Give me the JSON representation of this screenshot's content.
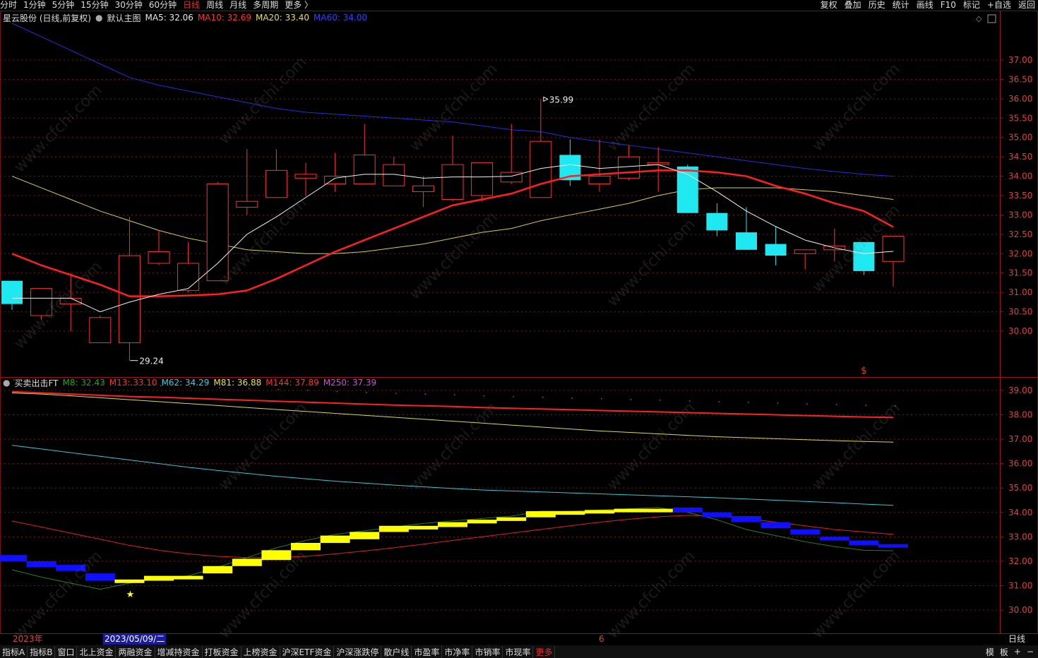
{
  "topbar": {
    "periods": [
      "分时",
      "1分钟",
      "5分钟",
      "15分钟",
      "30分钟",
      "60分钟",
      "日线",
      "周线",
      "月线",
      "多周期",
      "更多 〉"
    ],
    "active_period": "日线",
    "right_buttons": [
      "复权",
      "叠加",
      "历史",
      "统计",
      "画线",
      "F10",
      "标记",
      "+自选",
      "返回"
    ]
  },
  "main_chart": {
    "stock_label": "星云股份 (日线,前复权)",
    "template_label": "默认主图",
    "ma": [
      {
        "name": "MA5",
        "value": "32.06",
        "color": "#e8e8e8"
      },
      {
        "name": "MA10",
        "value": "32.69",
        "color": "#ff3030"
      },
      {
        "name": "MA20",
        "value": "33.40",
        "color": "#e8e040"
      },
      {
        "name": "MA60",
        "value": "34.00",
        "color": "#3040ff"
      }
    ],
    "high_label": "35.99",
    "low_label": "29.24",
    "signal_marker": "$",
    "y_ticks": [
      "37.00",
      "36.50",
      "36.00",
      "35.50",
      "35.00",
      "34.50",
      "34.00",
      "33.50",
      "33.00",
      "32.50",
      "32.00",
      "31.50",
      "31.00",
      "30.50",
      "30.00"
    ]
  },
  "sub_chart": {
    "indicator": "买卖出击FT",
    "lines": [
      {
        "name": "M8",
        "value": "32.43",
        "color": "#20a020"
      },
      {
        "name": "M13",
        "value": "33.10",
        "color": "#ff3030"
      },
      {
        "name": "M62",
        "value": "34.29",
        "color": "#30d0e0"
      },
      {
        "name": "M81",
        "value": "36.88",
        "color": "#e8e040"
      },
      {
        "name": "M144",
        "value": "37.89",
        "color": "#ff3030"
      },
      {
        "name": "M250",
        "value": "37.39",
        "color": "#e040e0"
      }
    ],
    "y_ticks": [
      "39.00",
      "38.00",
      "37.00",
      "36.00",
      "35.00",
      "34.00",
      "33.00",
      "32.00",
      "31.00",
      "30.00"
    ],
    "star_marker": "★"
  },
  "chart_data": {
    "type": "candlestick",
    "candles": [
      {
        "o": 31.3,
        "c": 30.7,
        "h": 31.3,
        "l": 30.55
      },
      {
        "o": 30.4,
        "c": 31.1,
        "h": 31.1,
        "l": 30.3
      },
      {
        "o": 30.7,
        "c": 30.85,
        "h": 31.5,
        "l": 30.0
      },
      {
        "o": 29.7,
        "c": 30.35,
        "h": 30.4,
        "l": 29.7
      },
      {
        "o": 29.7,
        "c": 31.95,
        "h": 32.95,
        "l": 29.24
      },
      {
        "o": 31.75,
        "c": 32.05,
        "h": 32.6,
        "l": 31.7
      },
      {
        "o": 31.05,
        "c": 31.75,
        "h": 32.3,
        "l": 31.0
      },
      {
        "o": 31.3,
        "c": 33.8,
        "h": 33.85,
        "l": 31.3
      },
      {
        "o": 33.2,
        "c": 33.35,
        "h": 34.7,
        "l": 33.0
      },
      {
        "o": 33.45,
        "c": 34.15,
        "h": 34.7,
        "l": 33.45
      },
      {
        "o": 33.95,
        "c": 34.05,
        "h": 34.35,
        "l": 33.5
      },
      {
        "o": 33.8,
        "c": 34.0,
        "h": 34.6,
        "l": 33.6
      },
      {
        "o": 33.8,
        "c": 34.55,
        "h": 35.35,
        "l": 33.95
      },
      {
        "o": 33.75,
        "c": 34.3,
        "h": 34.5,
        "l": 33.75
      },
      {
        "o": 33.6,
        "c": 33.75,
        "h": 34.0,
        "l": 33.2
      },
      {
        "o": 33.4,
        "c": 34.3,
        "h": 35.05,
        "l": 33.35
      },
      {
        "o": 33.5,
        "c": 34.35,
        "h": 34.35,
        "l": 33.35
      },
      {
        "o": 33.85,
        "c": 34.1,
        "h": 35.35,
        "l": 33.8
      },
      {
        "o": 33.45,
        "c": 34.9,
        "h": 35.99,
        "l": 33.45
      },
      {
        "o": 34.55,
        "c": 33.9,
        "h": 34.95,
        "l": 33.75
      },
      {
        "o": 33.8,
        "c": 34.0,
        "h": 34.95,
        "l": 33.6
      },
      {
        "o": 33.95,
        "c": 34.5,
        "h": 34.8,
        "l": 33.9
      },
      {
        "o": 34.3,
        "c": 34.35,
        "h": 34.75,
        "l": 33.6
      },
      {
        "o": 34.25,
        "c": 33.05,
        "h": 34.3,
        "l": 33.05
      },
      {
        "o": 33.05,
        "c": 32.6,
        "h": 33.3,
        "l": 32.45
      },
      {
        "o": 32.55,
        "c": 32.1,
        "h": 33.2,
        "l": 32.1
      },
      {
        "o": 32.25,
        "c": 31.95,
        "h": 32.7,
        "l": 31.7
      },
      {
        "o": 32.0,
        "c": 32.1,
        "h": 32.1,
        "l": 31.6
      },
      {
        "o": 32.1,
        "c": 32.2,
        "h": 32.65,
        "l": 31.8
      },
      {
        "o": 32.3,
        "c": 31.55,
        "h": 32.3,
        "l": 31.45
      },
      {
        "o": 31.8,
        "c": 32.45,
        "h": 32.45,
        "l": 31.15
      }
    ],
    "ma5": [
      30.85,
      30.85,
      30.85,
      30.5,
      30.75,
      30.95,
      31.1,
      31.75,
      32.5,
      32.95,
      33.45,
      33.95,
      34.05,
      34.05,
      33.95,
      33.98,
      33.98,
      34.0,
      34.2,
      34.3,
      34.2,
      34.25,
      34.3,
      34.05,
      33.6,
      33.1,
      32.7,
      32.35,
      32.15,
      32.0,
      32.06
    ],
    "ma10": [
      32.0,
      31.7,
      31.45,
      31.2,
      30.9,
      30.9,
      30.92,
      30.95,
      31.05,
      31.35,
      31.7,
      32.05,
      32.35,
      32.65,
      32.95,
      33.25,
      33.4,
      33.55,
      33.8,
      34.0,
      34.05,
      34.1,
      34.15,
      34.15,
      34.1,
      34.0,
      33.75,
      33.55,
      33.3,
      33.1,
      32.69
    ],
    "ma20": [
      34.0,
      33.7,
      33.4,
      33.1,
      32.85,
      32.6,
      32.4,
      32.25,
      32.1,
      32.05,
      32.0,
      32.0,
      32.05,
      32.15,
      32.25,
      32.4,
      32.55,
      32.65,
      32.85,
      33.0,
      33.15,
      33.3,
      33.5,
      33.65,
      33.7,
      33.7,
      33.7,
      33.65,
      33.6,
      33.5,
      33.4
    ],
    "ma60": [
      37.95,
      37.6,
      37.25,
      36.9,
      36.55,
      36.35,
      36.2,
      36.05,
      35.9,
      35.75,
      35.65,
      35.6,
      35.55,
      35.5,
      35.45,
      35.4,
      35.3,
      35.2,
      35.15,
      35.0,
      34.9,
      34.8,
      34.7,
      34.6,
      34.5,
      34.4,
      34.3,
      34.2,
      34.12,
      34.05,
      34.0
    ],
    "sub": {
      "m144": [
        38.95,
        38.9,
        38.85,
        38.8,
        38.75,
        38.72,
        38.68,
        38.64,
        38.6,
        38.56,
        38.52,
        38.48,
        38.44,
        38.4,
        38.37,
        38.34,
        38.3,
        38.27,
        38.24,
        38.21,
        38.18,
        38.15,
        38.12,
        38.09,
        38.06,
        38.03,
        38.0,
        37.97,
        37.94,
        37.91,
        37.89
      ],
      "m81": [
        38.9,
        38.85,
        38.78,
        38.7,
        38.62,
        38.54,
        38.46,
        38.38,
        38.3,
        38.22,
        38.14,
        38.06,
        37.98,
        37.9,
        37.82,
        37.74,
        37.66,
        37.58,
        37.5,
        37.42,
        37.34,
        37.28,
        37.22,
        37.16,
        37.1,
        37.06,
        37.02,
        36.98,
        36.94,
        36.91,
        36.88
      ],
      "m62": [
        36.75,
        36.6,
        36.45,
        36.3,
        36.15,
        36.0,
        35.85,
        35.72,
        35.6,
        35.48,
        35.38,
        35.28,
        35.2,
        35.12,
        35.05,
        34.98,
        34.92,
        34.88,
        34.84,
        34.8,
        34.76,
        34.72,
        34.68,
        34.64,
        34.6,
        34.55,
        34.5,
        34.45,
        34.4,
        34.34,
        34.29
      ],
      "m13": [
        33.65,
        33.4,
        33.15,
        32.9,
        32.65,
        32.45,
        32.3,
        32.2,
        32.15,
        32.15,
        32.2,
        32.3,
        32.42,
        32.55,
        32.7,
        32.85,
        33.0,
        33.15,
        33.3,
        33.45,
        33.6,
        33.72,
        33.82,
        33.88,
        33.85,
        33.75,
        33.6,
        33.45,
        33.3,
        33.2,
        33.1
      ],
      "m8": [
        31.65,
        31.35,
        31.1,
        30.85,
        31.1,
        31.3,
        31.4,
        31.75,
        32.15,
        32.55,
        32.85,
        33.1,
        33.25,
        33.4,
        33.55,
        33.65,
        33.75,
        33.85,
        34.05,
        34.05,
        34.1,
        34.15,
        34.2,
        34.0,
        33.7,
        33.3,
        33.05,
        32.8,
        32.6,
        32.45,
        32.43
      ],
      "bars": [
        {
          "o": 32.25,
          "c": 32.0
        },
        {
          "o": 32.0,
          "c": 31.75
        },
        {
          "o": 31.85,
          "c": 31.6
        },
        {
          "o": 31.5,
          "c": 31.2
        },
        {
          "o": 31.2,
          "c": 31.25
        },
        {
          "o": 31.2,
          "c": 31.4
        },
        {
          "o": 31.3,
          "c": 31.4
        },
        {
          "o": 31.5,
          "c": 31.8
        },
        {
          "o": 31.8,
          "c": 32.1
        },
        {
          "o": 32.05,
          "c": 32.45
        },
        {
          "o": 32.45,
          "c": 32.75
        },
        {
          "o": 32.75,
          "c": 33.05
        },
        {
          "o": 32.9,
          "c": 33.2
        },
        {
          "o": 33.2,
          "c": 33.45
        },
        {
          "o": 33.3,
          "c": 33.45
        },
        {
          "o": 33.4,
          "c": 33.6
        },
        {
          "o": 33.55,
          "c": 33.7
        },
        {
          "o": 33.65,
          "c": 33.8
        },
        {
          "o": 33.8,
          "c": 34.05
        },
        {
          "o": 33.95,
          "c": 34.05
        },
        {
          "o": 34.0,
          "c": 34.1
        },
        {
          "o": 34.05,
          "c": 34.15
        },
        {
          "o": 34.1,
          "c": 34.15
        },
        {
          "o": 34.2,
          "c": 34.0
        },
        {
          "o": 34.0,
          "c": 33.8
        },
        {
          "o": 33.85,
          "c": 33.6
        },
        {
          "o": 33.6,
          "c": 33.35
        },
        {
          "o": 33.3,
          "c": 33.1
        },
        {
          "o": 33.0,
          "c": 32.85
        },
        {
          "o": 32.85,
          "c": 32.65
        },
        {
          "o": 32.7,
          "c": 32.65
        }
      ]
    },
    "main_ylim": [
      29.0,
      37.5
    ],
    "sub_ylim": [
      29.8,
      39.2
    ]
  },
  "date_axis": {
    "year_label": "2023年",
    "cursor_date": "2023/05/09/二",
    "month_label": "6",
    "period": "日线"
  },
  "bottombar": {
    "tabs": [
      "指标A",
      "指标B",
      "窗口",
      "北上资金",
      "两融资金",
      "增减持资金",
      "打板资金",
      "上榜资金",
      "沪深ETF资金",
      "沪深涨跌停",
      "散户线",
      "市盈率",
      "市净率",
      "市销率",
      "市现率",
      "更多"
    ],
    "active": "更多",
    "right": [
      "模",
      "板",
      "+",
      "−"
    ]
  },
  "watermark": "www.cfchi.com",
  "colors": {
    "up": "#ff3030",
    "down": "#20e8f0",
    "grid": "#8a1010",
    "axis_text": "#e04040"
  }
}
